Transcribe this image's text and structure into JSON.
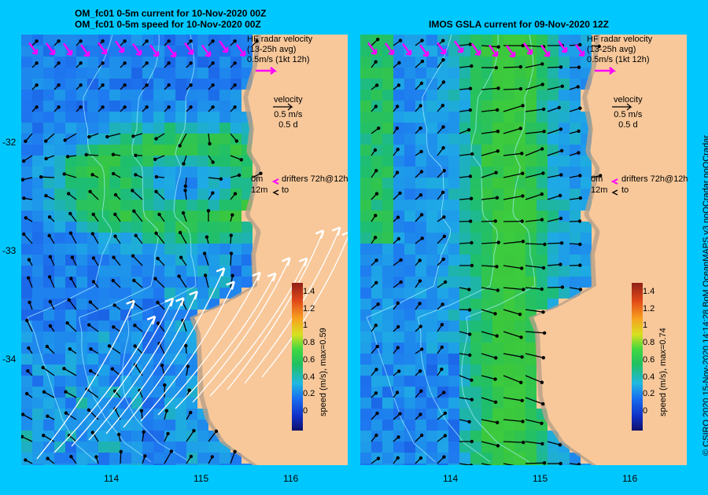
{
  "left_panel": {
    "title_line1": "OM_fc01 0-5m current for 10-Nov-2020 00Z",
    "title_line2": "OM_fc01 0-5m speed for 10-Nov-2020 00Z",
    "hf_radar": [
      "HF radar velocity",
      "(13-25h avg)",
      "0.5m/s (1kt 12h)"
    ],
    "velocity_key": [
      "velocity",
      "0.5 m/s",
      "0.5 d"
    ],
    "drifters": [
      "0m",
      "drifters 72h@12h",
      "12m",
      "to"
    ],
    "colorbar_title": "speed (m/s), max=0.59"
  },
  "right_panel": {
    "title": "IMOS GSLA current for 09-Nov-2020 12Z",
    "hf_radar": [
      "HF radar velocity",
      "(13-25h avg)",
      "0.5m/s (1kt 12h)"
    ],
    "velocity_key": [
      "velocity",
      "0.5 m/s",
      "0.5 d"
    ],
    "drifters": [
      "0m",
      "drifters 72h@12h",
      "12m",
      "to"
    ],
    "colorbar_title": "speed (m/s), max=0.74"
  },
  "colorbar_ticks": [
    "1.4",
    "1.2",
    "1",
    "0.8",
    "0.6",
    "0.4",
    "0.2",
    "0"
  ],
  "lat_ticks": [
    "-32",
    "-33",
    "-34"
  ],
  "lon_ticks": [
    "114",
    "115",
    "116"
  ],
  "credit": "© CSIRO 2020   15-Nov-2020 14:14:28 BoM OceanMAPS v3 noQCradar noQCradar",
  "colors": {
    "background": "#00c8ff",
    "land": "#f8c89a",
    "hf_radar_arrow": "#ff00ff"
  }
}
